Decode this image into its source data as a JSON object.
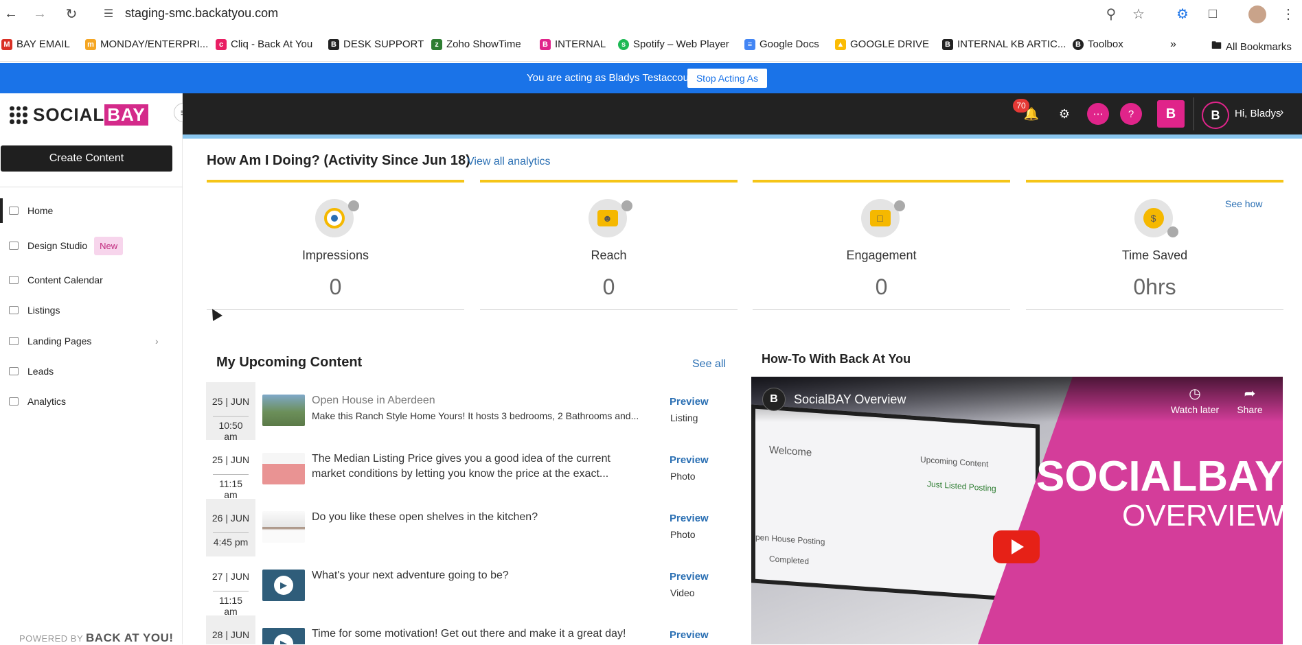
{
  "browser": {
    "url": "staging-smc.backatyou.com",
    "bookmarks": [
      {
        "label": "BAY EMAIL",
        "color": "#d93025"
      },
      {
        "label": "MONDAY/ENTERPRI...",
        "color": "#f5a623"
      },
      {
        "label": "Cliq - Back At You",
        "color": "#e91e63"
      },
      {
        "label": "DESK SUPPORT",
        "color": "#222222"
      },
      {
        "label": "Zoho ShowTime",
        "color": "#2e7d32"
      },
      {
        "label": "INTERNAL",
        "color": "#e0248a"
      },
      {
        "label": "Spotify – Web Player",
        "color": "#1db954"
      },
      {
        "label": "Google Docs",
        "color": "#4285f4"
      },
      {
        "label": "GOOGLE  DRIVE",
        "color": "#fbbc04"
      },
      {
        "label": "INTERNAL KB ARTIC...",
        "color": "#222222"
      },
      {
        "label": "Toolbox",
        "color": "#222222"
      }
    ],
    "all_bookmarks": "All Bookmarks"
  },
  "banner": {
    "text": "You are acting as Bladys Testaccount",
    "stop_label": "Stop Acting As"
  },
  "sidebar": {
    "logo_social": "SOCIAL",
    "logo_bay": "BAY",
    "create_label": "Create Content",
    "items": [
      {
        "label": "Home"
      },
      {
        "label": "Design Studio",
        "badge": "New"
      },
      {
        "label": "Content Calendar"
      },
      {
        "label": "Listings"
      },
      {
        "label": "Landing Pages"
      },
      {
        "label": "Leads"
      },
      {
        "label": "Analytics"
      }
    ],
    "powered_by": "POWERED BY",
    "powered_brand": "BACK AT YOU!"
  },
  "appbar": {
    "notif_count": "70",
    "brand_letter": "B",
    "avatar_letter": "B",
    "greeting": "Hi, Bladys"
  },
  "stats": {
    "title": "How Am I Doing? (Activity Since Jun 18)",
    "view_all": "View all analytics",
    "see_how": "See how",
    "cards": [
      {
        "label": "Impressions",
        "value": "0"
      },
      {
        "label": "Reach",
        "value": "0"
      },
      {
        "label": "Engagement",
        "value": "0"
      },
      {
        "label": "Time Saved",
        "value": "0hrs"
      }
    ]
  },
  "upcoming": {
    "title": "My Upcoming Content",
    "see_all": "See all",
    "preview_label": "Preview",
    "rows": [
      {
        "date": "25 | JUN",
        "time": "10:50 am",
        "title": "Open House in Aberdeen",
        "desc": "Make this Ranch Style Home Yours! It hosts 3 bedrooms, 2 Bathrooms and...",
        "type": "Listing"
      },
      {
        "date": "25 | JUN",
        "time": "11:15 am",
        "title": "The Median Listing Price gives you a good idea of the current market conditions by letting you know the price at the exact...",
        "desc": "",
        "type": "Photo"
      },
      {
        "date": "26 | JUN",
        "time": "4:45 pm",
        "title": "Do you like these open shelves in the kitchen?",
        "desc": "",
        "type": "Photo"
      },
      {
        "date": "27 | JUN",
        "time": "11:15 am",
        "title": "What's your next adventure going to be?",
        "desc": "",
        "type": "Video"
      },
      {
        "date": "28 | JUN",
        "time": "",
        "title": "Time for some motivation! Get out there and make it a great day!",
        "desc": "",
        "type": ""
      }
    ]
  },
  "howto": {
    "title": "How-To With Back At You",
    "video_title": "SocialBAY Overview",
    "channel_letter": "B",
    "watch_later": "Watch later",
    "share": "Share",
    "big1": "SOCIALBAY",
    "big2": "OVERVIEW",
    "laptop_welcome": "Welcome",
    "laptop_upcoming": "Upcoming Content",
    "laptop_listed": "Just Listed Posting",
    "laptop_open": "pen House Posting",
    "laptop_completed": "Completed"
  }
}
